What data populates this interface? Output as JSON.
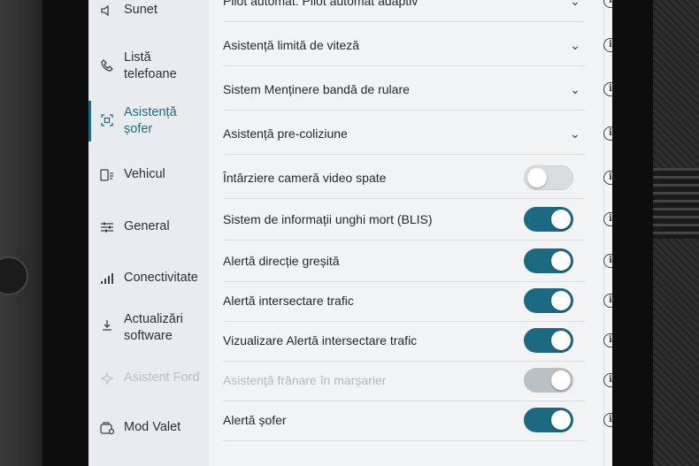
{
  "sidebar": {
    "items": [
      {
        "label": "Sunet",
        "icon": "speaker-icon",
        "state": "normal"
      },
      {
        "label": "Listă telefoane",
        "icon": "phone-icon",
        "state": "normal"
      },
      {
        "label": "Asistență șofer",
        "icon": "driver-assist-icon",
        "state": "active"
      },
      {
        "label": "Vehicul",
        "icon": "vehicle-icon",
        "state": "normal"
      },
      {
        "label": "General",
        "icon": "sliders-icon",
        "state": "normal"
      },
      {
        "label": "Conectivitate",
        "icon": "signal-icon",
        "state": "normal"
      },
      {
        "label": "Actualizări software",
        "icon": "download-icon",
        "state": "normal"
      },
      {
        "label": "Asistent Ford",
        "icon": "assistant-icon",
        "state": "disabled"
      },
      {
        "label": "Mod Valet",
        "icon": "valet-icon",
        "state": "normal"
      }
    ]
  },
  "settings": {
    "rows": [
      {
        "label": "Pilot automat: Pilot automat adaptiv",
        "control": "dropdown"
      },
      {
        "label": "Asistență limită de viteză",
        "control": "dropdown"
      },
      {
        "label": "Sistem Menținere bandă de rulare",
        "control": "dropdown"
      },
      {
        "label": "Asistență pre-coliziune",
        "control": "dropdown"
      },
      {
        "label": "Întârziere cameră video spate",
        "control": "toggle",
        "value": "off"
      },
      {
        "label": "Sistem de informații unghi mort (BLIS)",
        "control": "toggle",
        "value": "on"
      },
      {
        "label": "Alertă direcție greșită",
        "control": "toggle",
        "value": "on"
      },
      {
        "label": "Alertă intersectare trafic",
        "control": "toggle",
        "value": "on"
      },
      {
        "label": "Vizualizare Alertă intersectare trafic",
        "control": "toggle",
        "value": "on"
      },
      {
        "label": "Asistență frânare în marșarier",
        "control": "toggle",
        "value": "disabled"
      },
      {
        "label": "Alertă șofer",
        "control": "toggle",
        "value": "on"
      }
    ]
  },
  "colors": {
    "accent": "#1c6a82",
    "background": "#f1f3f4"
  }
}
